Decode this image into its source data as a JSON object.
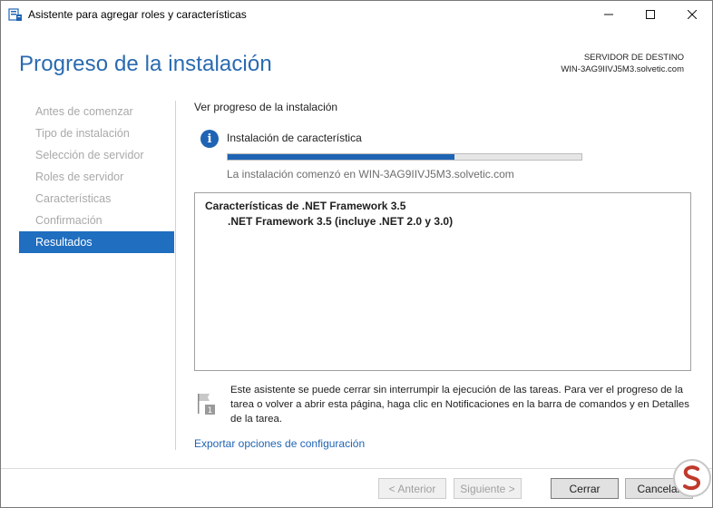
{
  "window": {
    "title": "Asistente para agregar roles y características",
    "minimize_glyph": "—",
    "maximize_glyph": "☐",
    "close_glyph": "✕"
  },
  "header": {
    "page_title": "Progreso de la instalación",
    "destination_label": "SERVIDOR DE DESTINO",
    "destination_server": "WIN-3AG9IIVJ5M3.solvetic.com"
  },
  "sidebar": {
    "items": [
      {
        "label": "Antes de comenzar",
        "active": false
      },
      {
        "label": "Tipo de instalación",
        "active": false
      },
      {
        "label": "Selección de servidor",
        "active": false
      },
      {
        "label": "Roles de servidor",
        "active": false
      },
      {
        "label": "Características",
        "active": false
      },
      {
        "label": "Confirmación",
        "active": false
      },
      {
        "label": "Resultados",
        "active": true
      }
    ]
  },
  "main": {
    "section_heading": "Ver progreso de la instalación",
    "status_icon": "info-icon",
    "status_text": "Instalación de característica",
    "progress_fraction": 0.64,
    "install_note": "La instalación comenzó en WIN-3AG9IIVJ5M3.solvetic.com",
    "results": {
      "title": "Características de .NET Framework 3.5",
      "item": ".NET Framework 3.5 (incluye .NET 2.0 y 3.0)"
    },
    "notice_icon": "notification-flag-icon",
    "notice": "Este asistente se puede cerrar sin interrumpir la ejecución de las tareas. Para ver el progreso de la tarea o volver a abrir esta página, haga clic en Notificaciones en la barra de comandos y en Detalles de la tarea.",
    "export_link": "Exportar opciones de configuración"
  },
  "footer": {
    "back_label": "< Anterior",
    "next_label": "Siguiente >",
    "close_label": "Cerrar",
    "cancel_label": "Cancelar"
  },
  "colors": {
    "accent": "#1f6ec0",
    "title_blue": "#2a6ab0",
    "progress": "#1f64b4"
  }
}
